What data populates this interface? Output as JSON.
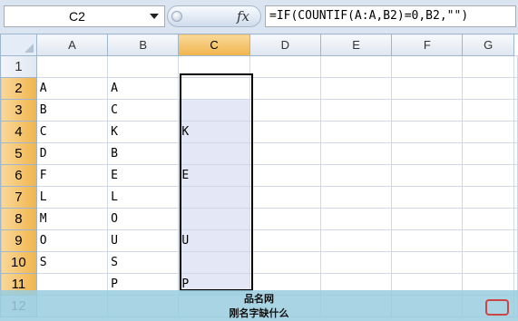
{
  "formula_bar": {
    "name_box": "C2",
    "fx_icon": "fx-icon",
    "formula": "=IF(COUNTIF(A:A,B2)=0,B2,\"\")"
  },
  "columns": [
    "A",
    "B",
    "C",
    "D",
    "E",
    "F",
    "G"
  ],
  "selected_column": "C",
  "rows": [
    {
      "num": "1",
      "A": "",
      "B": "",
      "C": ""
    },
    {
      "num": "2",
      "A": "A",
      "B": "A",
      "C": ""
    },
    {
      "num": "3",
      "A": "B",
      "B": "C",
      "C": ""
    },
    {
      "num": "4",
      "A": "C",
      "B": "K",
      "C": "K"
    },
    {
      "num": "5",
      "A": "D",
      "B": "B",
      "C": ""
    },
    {
      "num": "6",
      "A": "F",
      "B": "E",
      "C": "E"
    },
    {
      "num": "7",
      "A": "L",
      "B": "L",
      "C": ""
    },
    {
      "num": "8",
      "A": "M",
      "B": "O",
      "C": ""
    },
    {
      "num": "9",
      "A": "O",
      "B": "U",
      "C": "U"
    },
    {
      "num": "10",
      "A": "S",
      "B": "S",
      "C": ""
    },
    {
      "num": "11",
      "A": "",
      "B": "P",
      "C": "P"
    },
    {
      "num": "12",
      "A": "",
      "B": "",
      "C": ""
    }
  ],
  "banner": {
    "line1": "品名网",
    "line2": "刚名字缺什么"
  },
  "colors": {
    "header_bg": "#dfe6ef",
    "selected_header": "#f1b44c",
    "selection_fill": "#e4e8f6",
    "banner": "#99cdde"
  }
}
